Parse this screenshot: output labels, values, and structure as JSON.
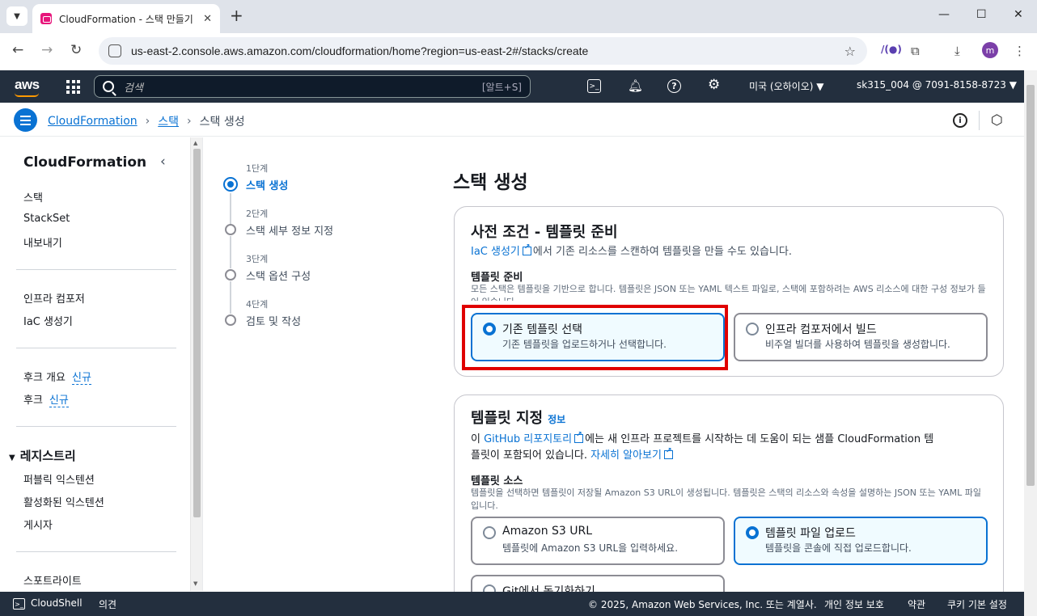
{
  "browser": {
    "tab_title": "CloudFormation - 스택 만들기",
    "url": "us-east-2.console.aws.amazon.com/cloudformation/home?region=us-east-2#/stacks/create",
    "avatar_letter": "m"
  },
  "aws_nav": {
    "logo": "aws",
    "search_placeholder": "검색",
    "search_shortcut": "[알트+S]",
    "region": "미국 (오하이오) ▼",
    "account": "sk315_004 @ 7091-8158-8723 ▼"
  },
  "breadcrumb": {
    "items": [
      "CloudFormation",
      "스택"
    ],
    "current": "스택 생성"
  },
  "sidebar": {
    "title": "CloudFormation",
    "group1": [
      "스택",
      "StackSet",
      "내보내기"
    ],
    "group2": [
      "인프라 컴포저",
      "IaC 생성기"
    ],
    "group3": [
      {
        "label": "후크 개요",
        "badge": "신규"
      },
      {
        "label": "후크",
        "badge": "신규"
      }
    ],
    "registry_title": "레지스트리",
    "registry_items": [
      "퍼블릭 익스텐션",
      "활성화된 익스텐션",
      "게시자"
    ],
    "last_item": "스포트라이트"
  },
  "steps": [
    {
      "num": "1단계",
      "label": "스택 생성",
      "active": true
    },
    {
      "num": "2단계",
      "label": "스택 세부 정보 지정",
      "active": false
    },
    {
      "num": "3단계",
      "label": "스택 옵션 구성",
      "active": false
    },
    {
      "num": "4단계",
      "label": "검토 및 작성",
      "active": false
    }
  ],
  "main": {
    "title": "스택 생성",
    "prereq": {
      "heading": "사전 조건 - 템플릿 준비",
      "iac_link": "IaC 생성기",
      "iac_text": "에서 기존 리소스를 스캔하여 템플릿을 만들 수도 있습니다.",
      "field_label": "템플릿 준비",
      "field_desc": "모든 스택은 템플릿을 기반으로 합니다. 템플릿은 JSON 또는 YAML 텍스트 파일로, 스택에 포함하려는 AWS 리소스에 대한 구성 정보가 들어 있습니다.",
      "options": [
        {
          "label": "기존 템플릿 선택",
          "desc": "기존 템플릿을 업로드하거나 선택합니다.",
          "selected": true
        },
        {
          "label": "인프라 컴포저에서 빌드",
          "desc": "비주얼 빌더를 사용하여 템플릿을 생성합니다.",
          "selected": false
        }
      ]
    },
    "template": {
      "heading": "템플릿 지정",
      "info": "정보",
      "line1_pre": "이 ",
      "github_link": "GitHub 리포지토리",
      "line1_post": "에는 새 인프라 프로젝트를 시작하는 데 도움이 되는 샘플 CloudFormation 템",
      "line2_pre": "플릿이 포함되어 있습니다. ",
      "learn_more": "자세히 알아보기",
      "source_label": "템플릿 소스",
      "source_desc": "템플릿을 선택하면 템플릿이 저장될 Amazon S3 URL이 생성됩니다. 템플릿은 스택의 리소스와 속성을 설명하는 JSON 또는 YAML 파일입니다.",
      "options": [
        {
          "label": "Amazon S3 URL",
          "desc": "템플릿에 Amazon S3 URL을 입력하세요.",
          "selected": false
        },
        {
          "label": "템플릿 파일 업로드",
          "desc": "템플릿을 콘솔에 직접 업로드합니다.",
          "selected": true
        },
        {
          "label": "Git에서 동기화하기",
          "desc": "",
          "selected": false
        }
      ]
    }
  },
  "footer": {
    "cloudshell": "CloudShell",
    "feedback": "의견",
    "copyright": "© 2025, Amazon Web Services, Inc. 또는 계열사.",
    "privacy": "개인 정보 보호",
    "terms": "약관",
    "cookies": "쿠키 기본 설정"
  }
}
